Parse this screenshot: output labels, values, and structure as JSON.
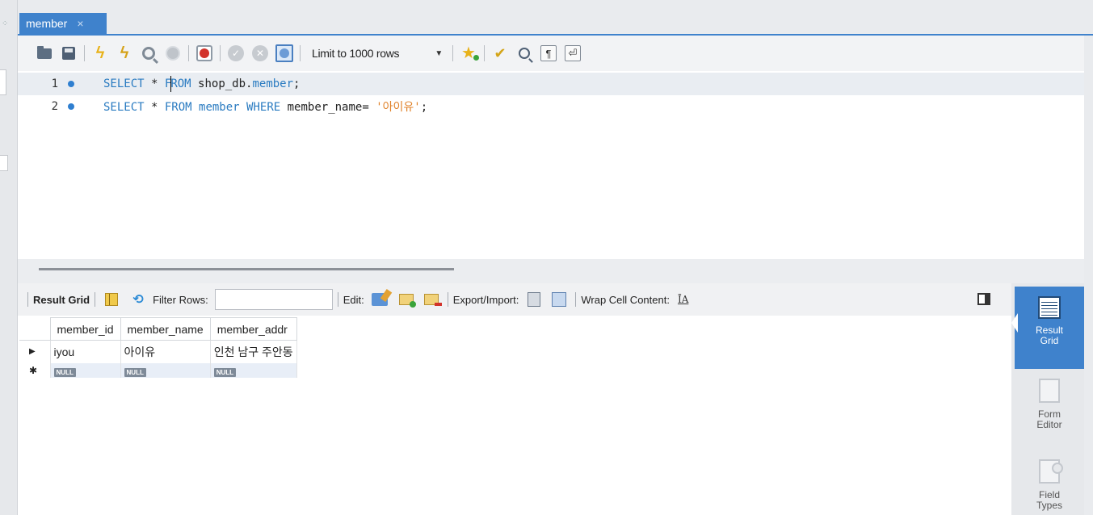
{
  "tab": {
    "title": "member",
    "close": "×"
  },
  "toolbar": {
    "limit_label": "Limit to 1000 rows"
  },
  "editor": {
    "lines": [
      {
        "num": "1",
        "kw1": "SELECT",
        "star": " * ",
        "kw2_pre": "F",
        "kw2_post": "ROM",
        "rest": " shop_db.",
        "ident2": "member",
        "end": ";"
      },
      {
        "num": "2",
        "kw1": "SELECT",
        "star": " * ",
        "kw2": "FROM",
        "table": " member ",
        "kw3": "WHERE",
        "cond": " member_name= ",
        "str": "'아이유'",
        "end": ";"
      }
    ]
  },
  "result_toolbar": {
    "result_grid": "Result Grid",
    "filter_rows": "Filter Rows:",
    "edit": "Edit:",
    "export_import": "Export/Import:",
    "wrap": "Wrap Cell Content:",
    "wrap_icon": "ĪA"
  },
  "grid": {
    "columns": [
      "member_id",
      "member_name",
      "member_addr"
    ],
    "rows": [
      [
        "iyou",
        "아이유",
        "인천 남구 주안동"
      ]
    ],
    "null_label": "NULL",
    "current_row_marker": "▶",
    "new_row_marker": "✱"
  },
  "side_panel": {
    "items": [
      {
        "label1": "Result",
        "label2": "Grid"
      },
      {
        "label1": "Form",
        "label2": "Editor"
      },
      {
        "label1": "Field",
        "label2": "Types"
      }
    ]
  }
}
